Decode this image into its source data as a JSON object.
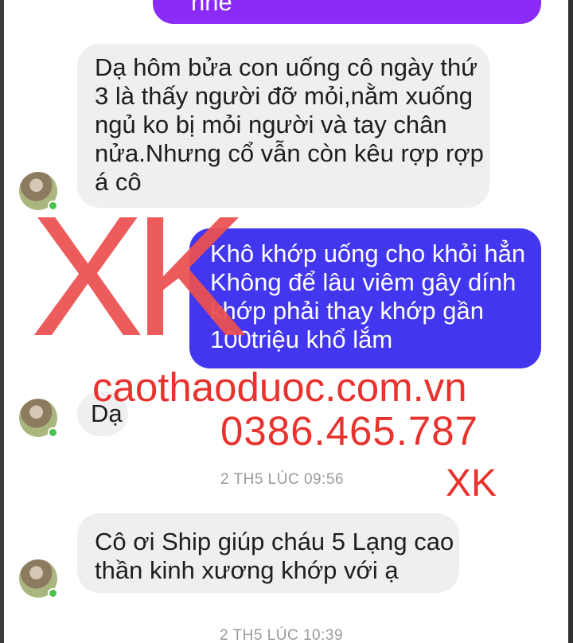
{
  "conversation": {
    "top_bubble_partial": "nhé",
    "messages": [
      {
        "sender": "contact",
        "lines": [
          "Dạ hôm bửa con uống cô ngày thứ",
          "3 là thấy người đỡ mỏi,nằm xuống",
          "ngủ ko bị mỏi người và tay chân",
          "nửa.Nhưng cổ vẫn còn kêu rợp rợp",
          "á cô"
        ]
      },
      {
        "sender": "me",
        "lines": [
          "Khô khớp uống cho khỏi hẳn",
          "Không để lâu viêm gây dính",
          "khớp phải thay khớp gần",
          "100triệu khổ lắm"
        ]
      },
      {
        "sender": "contact",
        "lines": [
          "Dạ"
        ]
      },
      {
        "sender": "contact",
        "lines": [
          "Cô ơi Ship giúp cháu 5 Lạng cao",
          "thần kinh xương khớp với ạ"
        ]
      }
    ],
    "timestamps": [
      "2 TH5 LÚC 09:56",
      "2 TH5 LÚC 10:39"
    ]
  },
  "watermark": {
    "big_mark": "XK",
    "website": "caothaoduoc.com.vn",
    "phone": "0386.465.787",
    "small_mark": "XK"
  },
  "colors": {
    "incoming_bubble": "#efefef",
    "outgoing_bubble": "#4336ef",
    "top_bubble": "#8a2cf5",
    "watermark_red": "#e8322e",
    "online_dot": "#47c44a",
    "timestamp_gray": "#9a9a9a"
  }
}
